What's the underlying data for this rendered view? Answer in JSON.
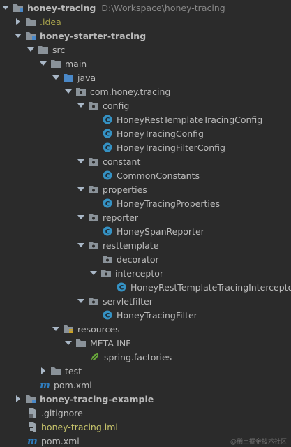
{
  "tree": {
    "root": {
      "label": "honey-tracing",
      "path": "D:\\Workspace\\honey-tracing"
    },
    "idea": {
      "label": ".idea"
    },
    "starter": {
      "label": "honey-starter-tracing"
    },
    "src": {
      "label": "src"
    },
    "main": {
      "label": "main"
    },
    "java": {
      "label": "java"
    },
    "pkg": {
      "label": "com.honey.tracing"
    },
    "config": {
      "label": "config"
    },
    "cls_rest_template_config": {
      "label": "HoneyRestTemplateTracingConfig"
    },
    "cls_tracing_config": {
      "label": "HoneyTracingConfig"
    },
    "cls_filter_config": {
      "label": "HoneyTracingFilterConfig"
    },
    "constant": {
      "label": "constant"
    },
    "cls_common_constants": {
      "label": "CommonConstants"
    },
    "properties": {
      "label": "properties"
    },
    "cls_tracing_properties": {
      "label": "HoneyTracingProperties"
    },
    "reporter": {
      "label": "reporter"
    },
    "cls_span_reporter": {
      "label": "HoneySpanReporter"
    },
    "resttemplate": {
      "label": "resttemplate"
    },
    "decorator": {
      "label": "decorator"
    },
    "interceptor": {
      "label": "interceptor"
    },
    "cls_interceptor": {
      "label": "HoneyRestTemplateTracingInterceptor"
    },
    "servletfilter": {
      "label": "servletfilter"
    },
    "cls_tracing_filter": {
      "label": "HoneyTracingFilter"
    },
    "resources": {
      "label": "resources"
    },
    "metainf": {
      "label": "META-INF"
    },
    "spring_factories": {
      "label": "spring.factories"
    },
    "test": {
      "label": "test"
    },
    "starter_pom": {
      "label": "pom.xml"
    },
    "example": {
      "label": "honey-tracing-example"
    },
    "gitignore": {
      "label": ".gitignore"
    },
    "iml": {
      "label": "honey-tracing.iml"
    },
    "root_pom": {
      "label": "pom.xml"
    }
  },
  "watermark": "@稀土掘金技术社区",
  "colors": {
    "background": "#2b2b2b",
    "text": "#bbbbbb",
    "folder": "#8a9299",
    "source_folder": "#4a88c7",
    "class_icon": "#3592c4",
    "excluded_text": "#c6c36b",
    "maven": "#2f7ec1"
  }
}
